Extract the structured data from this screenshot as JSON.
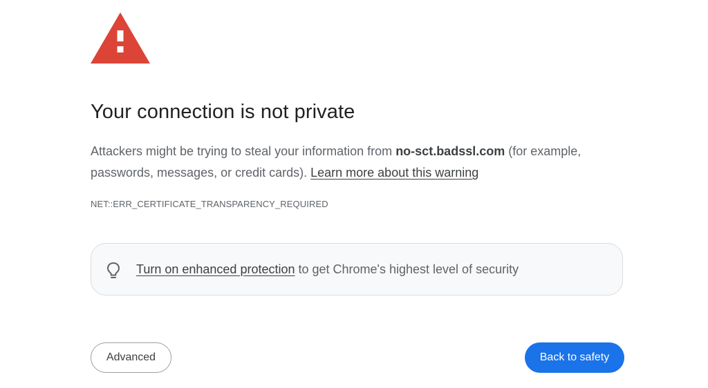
{
  "interstitial": {
    "heading": "Your connection is not private",
    "explanation_before": "Attackers might be trying to steal your information from ",
    "host": "no-sct.badssl.com",
    "explanation_after": " (for example, passwords, messages, or credit cards). ",
    "learn_more_link": "Learn more about this warning",
    "error_code": "NET::ERR_CERTIFICATE_TRANSPARENCY_REQUIRED",
    "warning_icon": "warning-triangle-icon",
    "warning_color": "#db4437"
  },
  "promo": {
    "icon": "lightbulb-icon",
    "link_text": "Turn on enhanced protection",
    "text_after": " to get Chrome's highest level of security"
  },
  "buttons": {
    "advanced_label": "Advanced",
    "back_to_safety_label": "Back to safety",
    "primary_color": "#1a73e8"
  }
}
